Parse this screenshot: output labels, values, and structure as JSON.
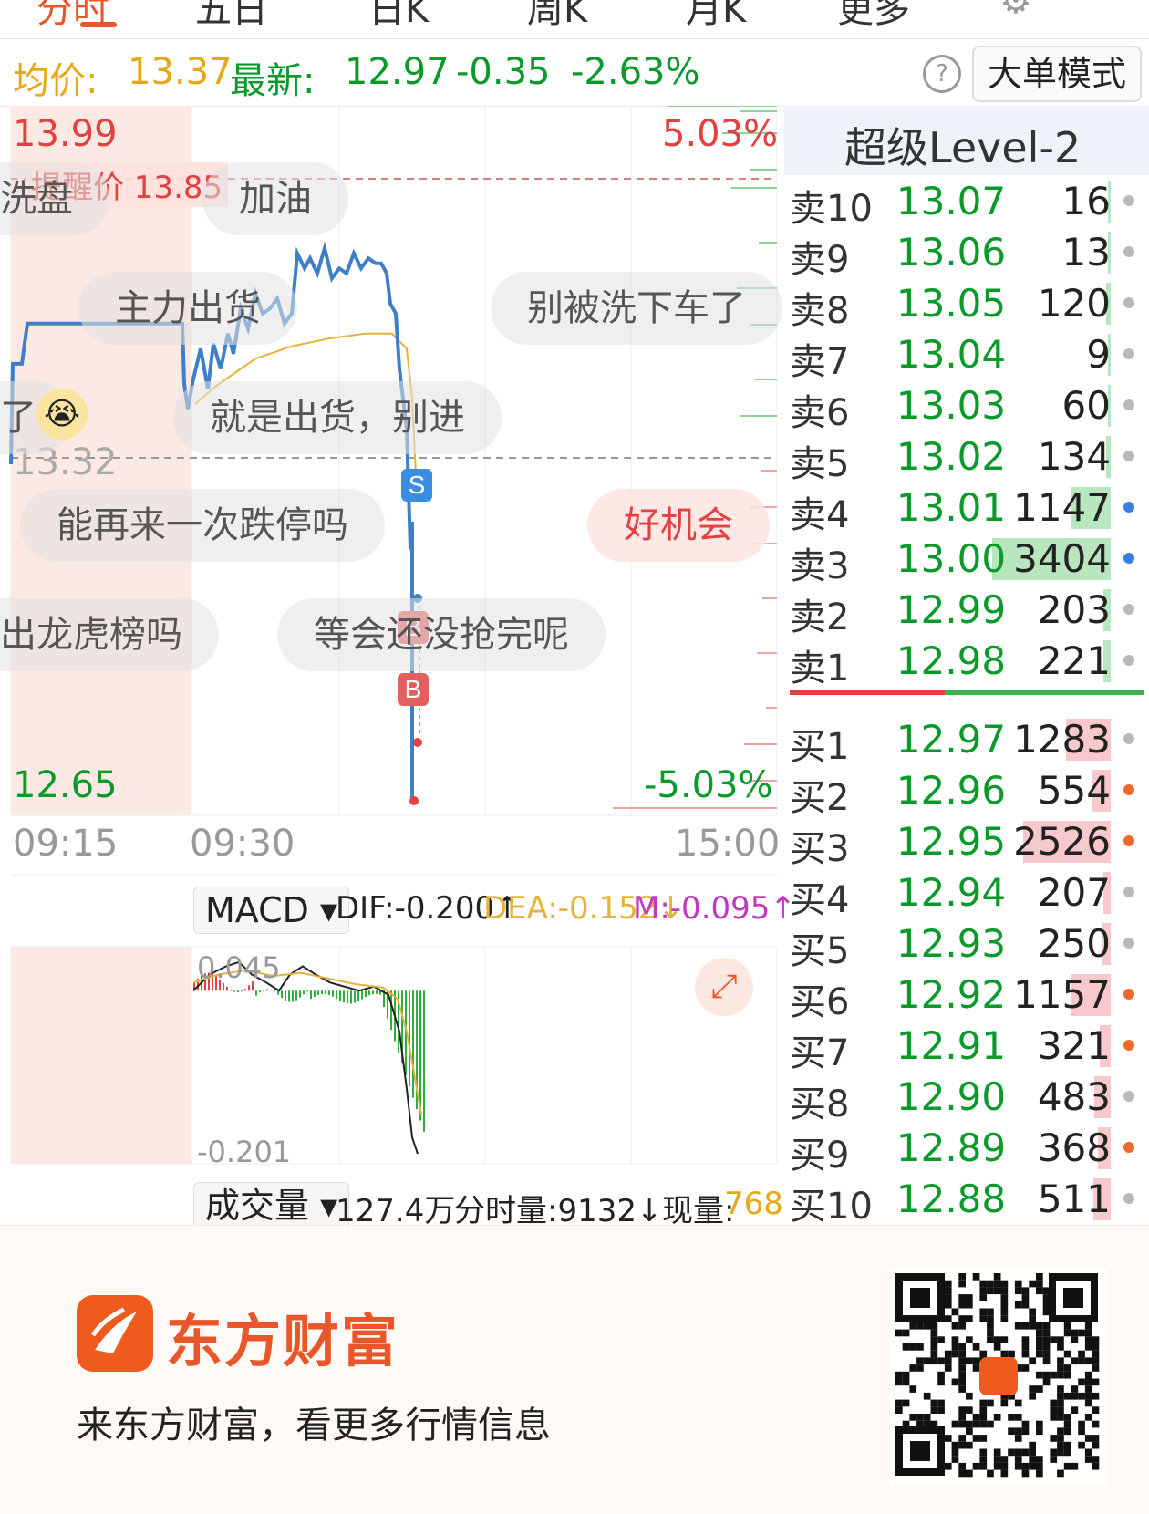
{
  "tabs": [
    {
      "label": "分时",
      "active": true
    },
    {
      "label": "五日",
      "active": false
    },
    {
      "label": "日K",
      "active": false
    },
    {
      "label": "周K",
      "active": false
    },
    {
      "label": "月K",
      "active": false
    },
    {
      "label": "更多",
      "active": false
    }
  ],
  "price_bar": {
    "avg_label": "均价:",
    "avg_value": "13.37",
    "latest_label": "最新:",
    "latest_value": "12.97",
    "change": "-0.35",
    "change_pct": "-2.63%",
    "help_icon": "?",
    "big_order_button": "大单模式"
  },
  "chart": {
    "y_top": "13.99",
    "y_top_pct": "5.03%",
    "alert_label": "提醒价 13.85",
    "y_mid": "13.32",
    "y_bottom": "12.65",
    "y_bottom_pct": "-5.03%",
    "x_labels": [
      "09:15",
      "09:30",
      "15:00"
    ],
    "markers": {
      "sell": "S",
      "buy1": "B",
      "buy2": "B"
    },
    "danmu": [
      "洗盘",
      "加油",
      "主力出货",
      "别被洗下车了",
      "了",
      "就是出货，别进",
      "能再来一次跌停吗",
      "好机会",
      "出龙虎榜吗",
      "等会还没抢完呢"
    ]
  },
  "macd": {
    "selector_label": "MACD ▾",
    "dif": "DIF:-0.200↑",
    "dea": "DEA:-0.152↓",
    "m": "M:-0.095↑",
    "top_value": "0.045",
    "bottom_value": "-0.201"
  },
  "volume": {
    "selector_label": "成交量 ▾",
    "total": "127.4万",
    "minute_volume": "分时量:9132↓",
    "current_label": "现量:",
    "current_value": "768"
  },
  "level2": {
    "title": "超级Level-2",
    "asks": [
      {
        "label": "卖10",
        "price": "13.07",
        "volume": "16",
        "bar_fraction": 0.005,
        "dot": "gray"
      },
      {
        "label": "卖9",
        "price": "13.06",
        "volume": "13",
        "bar_fraction": 0.004,
        "dot": "gray"
      },
      {
        "label": "卖8",
        "price": "13.05",
        "volume": "120",
        "bar_fraction": 0.035,
        "dot": "gray"
      },
      {
        "label": "卖7",
        "price": "13.04",
        "volume": "9",
        "bar_fraction": 0.003,
        "dot": "gray"
      },
      {
        "label": "卖6",
        "price": "13.03",
        "volume": "60",
        "bar_fraction": 0.018,
        "dot": "gray"
      },
      {
        "label": "卖5",
        "price": "13.02",
        "volume": "134",
        "bar_fraction": 0.039,
        "dot": "gray"
      },
      {
        "label": "卖4",
        "price": "13.01",
        "volume": "1147",
        "bar_fraction": 0.337,
        "dot": "blue"
      },
      {
        "label": "卖3",
        "price": "13.00",
        "volume": "3404",
        "bar_fraction": 1.0,
        "dot": "blue"
      },
      {
        "label": "卖2",
        "price": "12.99",
        "volume": "203",
        "bar_fraction": 0.06,
        "dot": "gray"
      },
      {
        "label": "卖1",
        "price": "12.98",
        "volume": "221",
        "bar_fraction": 0.065,
        "dot": "gray"
      }
    ],
    "bids": [
      {
        "label": "买1",
        "price": "12.97",
        "volume": "1283",
        "bar_fraction": 0.377,
        "dot": "gray"
      },
      {
        "label": "买2",
        "price": "12.96",
        "volume": "554",
        "bar_fraction": 0.163,
        "dot": "orange"
      },
      {
        "label": "买3",
        "price": "12.95",
        "volume": "2526",
        "bar_fraction": 0.742,
        "dot": "orange"
      },
      {
        "label": "买4",
        "price": "12.94",
        "volume": "207",
        "bar_fraction": 0.061,
        "dot": "gray"
      },
      {
        "label": "买5",
        "price": "12.93",
        "volume": "250",
        "bar_fraction": 0.073,
        "dot": "gray"
      },
      {
        "label": "买6",
        "price": "12.92",
        "volume": "1157",
        "bar_fraction": 0.34,
        "dot": "orange"
      },
      {
        "label": "买7",
        "price": "12.91",
        "volume": "321",
        "bar_fraction": 0.094,
        "dot": "orange"
      },
      {
        "label": "买8",
        "price": "12.90",
        "volume": "483",
        "bar_fraction": 0.142,
        "dot": "gray"
      },
      {
        "label": "买9",
        "price": "12.89",
        "volume": "368",
        "bar_fraction": 0.108,
        "dot": "orange"
      },
      {
        "label": "买10",
        "price": "12.88",
        "volume": "511",
        "bar_fraction": 0.15,
        "dot": "gray"
      }
    ]
  },
  "footer": {
    "brand": "东方财富",
    "slogan": "来东方财富，看更多行情信息"
  },
  "colors": {
    "up_red": "#e04141",
    "down_green": "#0a9a2a",
    "avg_yellow": "#e6a817",
    "line_blue": "#3f7fc8",
    "accent_orange": "#e8562a"
  }
}
